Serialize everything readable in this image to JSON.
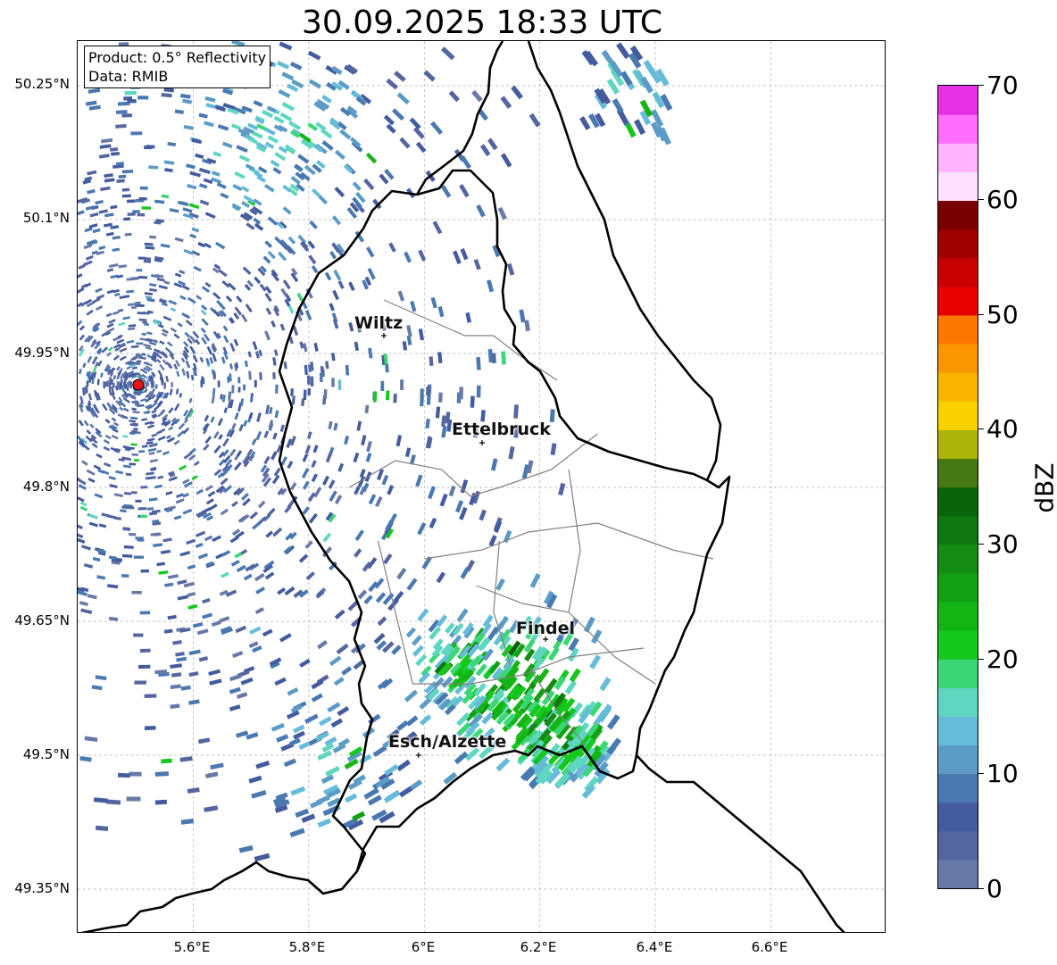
{
  "title": "30.09.2025 18:33 UTC",
  "info": {
    "product": "Product: 0.5° Reflectivity",
    "data": "Data: RMIB"
  },
  "lat_ticks": [
    "50.25°N",
    "50.1°N",
    "49.95°N",
    "49.8°N",
    "49.65°N",
    "49.5°N",
    "49.35°N"
  ],
  "lon_ticks": [
    "5.6°E",
    "5.8°E",
    "6°E",
    "6.2°E",
    "6.4°E",
    "6.6°E"
  ],
  "map_extent": {
    "lon_min": 5.4,
    "lon_max": 6.8,
    "lat_min": 49.3,
    "lat_max": 50.3
  },
  "cities": [
    {
      "name": "Wiltz",
      "lon": 5.93,
      "lat": 49.97
    },
    {
      "name": "Ettelbruck",
      "lon": 6.1,
      "lat": 49.85
    },
    {
      "name": "Findel",
      "lon": 6.21,
      "lat": 49.63
    },
    {
      "name": "Esch/Alzette",
      "lon": 5.99,
      "lat": 49.5
    }
  ],
  "radar_site": {
    "lon": 5.505,
    "lat": 49.915,
    "color": "#e8141c"
  },
  "colorbar": {
    "unit": "dBZ",
    "ticks": [
      "0",
      "10",
      "20",
      "30",
      "40",
      "50",
      "60",
      "70"
    ],
    "min": 0,
    "max": 70,
    "colors": [
      "#6879a8",
      "#5565a0",
      "#445c9e",
      "#4a78b0",
      "#5b9bc6",
      "#66bcd8",
      "#5ed6c0",
      "#3dd676",
      "#14c81e",
      "#14b414",
      "#14a014",
      "#148c14",
      "#107810",
      "#0a640a",
      "#467814",
      "#aab40a",
      "#fad200",
      "#fab400",
      "#fa9600",
      "#fa7800",
      "#e60000",
      "#c80000",
      "#a00000",
      "#780000",
      "#ffe0ff",
      "#ffb4ff",
      "#ff6eff",
      "#e632e6"
    ]
  },
  "colors": {
    "border_country": "#000000",
    "border_canton": "#808080",
    "grid": "#b0b0b0"
  }
}
